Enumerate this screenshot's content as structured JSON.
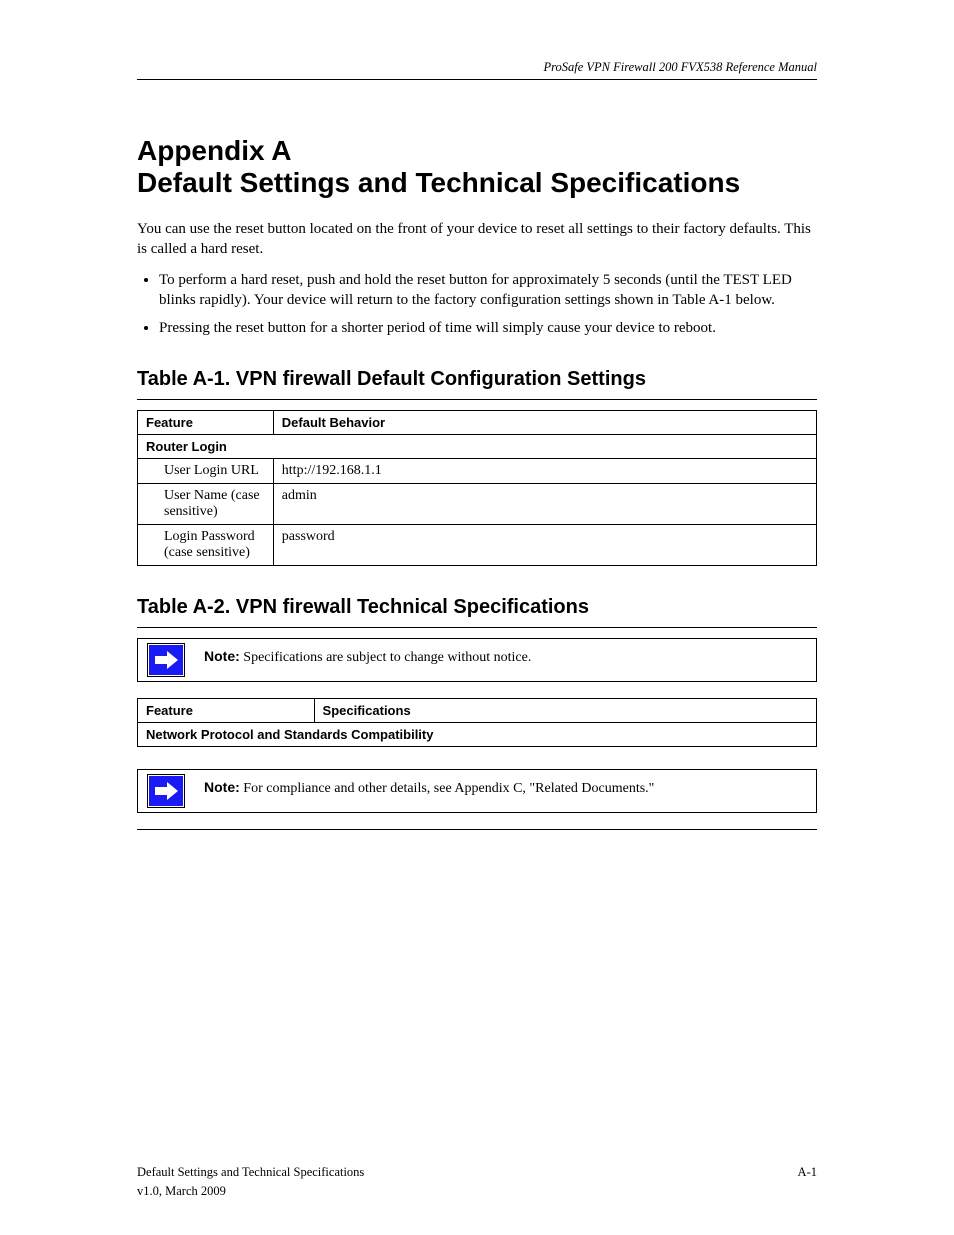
{
  "header": {
    "right": "ProSafe VPN Firewall 200 FVX538 Reference Manual"
  },
  "appendix_title": "Appendix A\nDefault Settings and Technical Specifications",
  "intro": "You can use the reset button located on the front of your device to reset all settings to their factory defaults. This is called a hard reset.",
  "bullets": [
    "To perform a hard reset, push and hold the reset button for approximately 5 seconds (until the TEST LED blinks rapidly). Your device will return to the factory configuration settings shown in Table A-1 below.",
    "Pressing the reset button for a shorter period of time will simply cause your device to reboot."
  ],
  "table_a1": {
    "caption": "Table A-1.   VPN firewall Default Configuration Settings",
    "headers": [
      "Feature",
      "Default Behavior"
    ],
    "section_label": "Router Login",
    "rows": [
      [
        "User Login URL",
        "http://192.168.1.1"
      ],
      [
        "User Name (case sensitive)",
        "admin"
      ],
      [
        "Login Password (case sensitive)",
        "password"
      ]
    ]
  },
  "table_a2": {
    "caption": "Table A-2.   VPN firewall Technical Specifications",
    "note_before": "Specifications are subject to change without notice.",
    "headers": [
      "Feature",
      "Specifications"
    ],
    "section_label": "Network Protocol and Standards Compatibility"
  },
  "note_after": {
    "label": "Note:",
    "text": "For compliance and other details, see Appendix C, \"Related Documents.\""
  },
  "footer": {
    "left_line1": "Default Settings and Technical Specifications",
    "left_line2": "v1.0, March 2009",
    "right": "A-1"
  }
}
